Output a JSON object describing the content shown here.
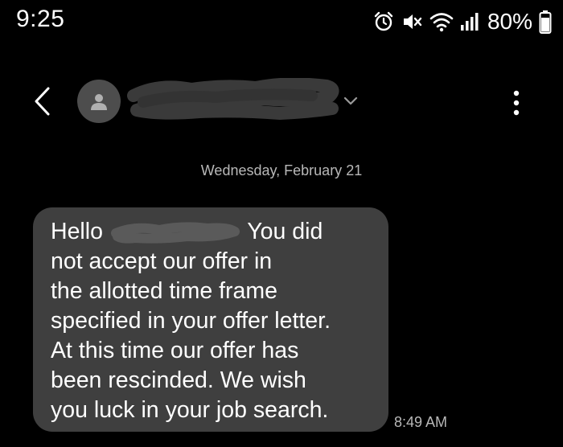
{
  "status_bar": {
    "time": "9:25",
    "battery_percent": "80%",
    "icons": [
      "alarm-icon",
      "vibrate-mute-icon",
      "wifi-icon",
      "cellular-signal-icon",
      "battery-icon"
    ]
  },
  "header": {
    "back_icon": "chevron-left-icon",
    "avatar_icon": "person-icon",
    "contact_name_redacted": true,
    "expand_icon": "chevron-down-icon",
    "more_icon": "more-vertical-icon"
  },
  "conversation": {
    "date_separator": "Wednesday, February 21",
    "message": {
      "line1_before": "Hello",
      "line1_after": "You did",
      "lines": [
        "not accept our offer in",
        "the allotted time frame",
        "specified in your offer letter.",
        "At this time our offer has",
        "been rescinded.  We wish",
        "you luck in your job search."
      ],
      "timestamp": "8:49 AM"
    }
  },
  "colors": {
    "background": "#000000",
    "bubble": "#3f3f3f",
    "secondary_text": "#b8b8b8",
    "avatar": "#4d4d4d"
  }
}
